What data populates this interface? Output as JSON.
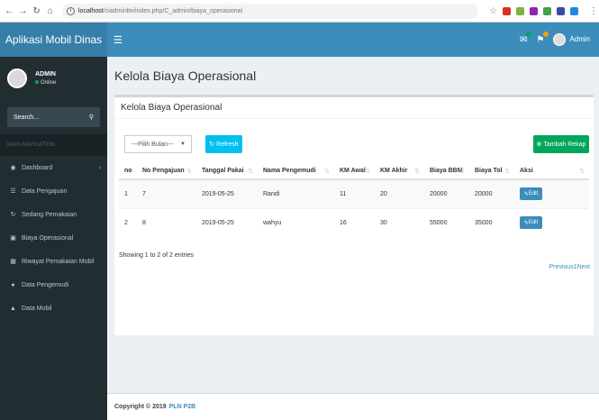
{
  "browser": {
    "url_host": "localhost",
    "url_path": "/ciadminlte/index.php/C_admin/biaya_operasional"
  },
  "header": {
    "logo": "Aplikasi Mobil Dinas",
    "user": "Admin"
  },
  "sidebar": {
    "user_name": "ADMIN",
    "user_status": "Online",
    "search_placeholder": "Search...",
    "section": "MAIN NAVIGATION",
    "items": [
      {
        "label": "Dashboard"
      },
      {
        "label": "Data Pengajuan"
      },
      {
        "label": "Sedang Pemakaian"
      },
      {
        "label": "Biaya Operasional"
      },
      {
        "label": "Riwayat Pemakaian Mobil"
      },
      {
        "label": "Data Pengemudi"
      },
      {
        "label": "Data Mobil"
      }
    ]
  },
  "main": {
    "page_title": "Kelola Biaya Operasional",
    "box_title": "Kelola Biaya Operasional",
    "select_value": "---Pilih Bulan---",
    "refresh_label": "Refresh",
    "add_label": "Tambah Rekap",
    "columns": [
      "no",
      "No Pengajuan",
      "Tanggal Pakai",
      "Nama Pengemudi",
      "KM Awal",
      "KM Akhir",
      "Biaya BBM",
      "Biaya Tol",
      "Aksi"
    ],
    "rows": [
      {
        "no": "1",
        "pengajuan": "7",
        "tanggal": "2019-05-25",
        "pengemudi": "Randi",
        "km_awal": "11",
        "km_akhir": "20",
        "bbm": "20000",
        "tol": "20000",
        "aksi": "Edit"
      },
      {
        "no": "2",
        "pengajuan": "8",
        "tanggal": "2019-05-25",
        "pengemudi": "wahyu",
        "km_awal": "16",
        "km_akhir": "30",
        "bbm": "55000",
        "tol": "35000",
        "aksi": "Edit"
      }
    ],
    "showing": "Showing 1 to 2 of 2 entries",
    "pagination": "Previous1Next"
  },
  "footer": {
    "text": "Copyright © 2019",
    "brand": "PLN P2B"
  }
}
